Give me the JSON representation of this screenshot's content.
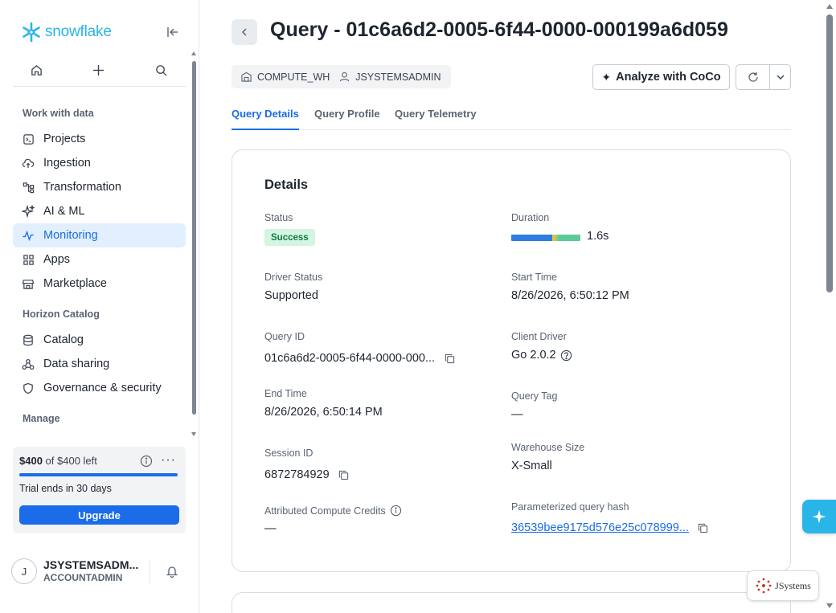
{
  "brand": {
    "name": "snowflake",
    "color": "#29b5e8"
  },
  "sidebar": {
    "sections": [
      {
        "label": "Work with data"
      },
      {
        "label": "Horizon Catalog"
      },
      {
        "label": "Manage"
      }
    ],
    "items": [
      {
        "label": "Projects",
        "icon": "projects-icon"
      },
      {
        "label": "Ingestion",
        "icon": "cloud-upload-icon"
      },
      {
        "label": "Transformation",
        "icon": "transformation-icon"
      },
      {
        "label": "AI & ML",
        "icon": "sparkles-icon"
      },
      {
        "label": "Monitoring",
        "icon": "activity-icon",
        "active": true
      },
      {
        "label": "Apps",
        "icon": "grid-icon"
      },
      {
        "label": "Marketplace",
        "icon": "store-icon"
      },
      {
        "label": "Catalog",
        "icon": "database-icon"
      },
      {
        "label": "Data sharing",
        "icon": "share-icon"
      },
      {
        "label": "Governance & security",
        "icon": "shield-icon"
      }
    ],
    "credits": {
      "amount": "$400",
      "of_text": "of $400 left",
      "remaining_fraction": 1.0,
      "trial_text": "Trial ends in 30 days",
      "upgrade_label": "Upgrade",
      "more_label": "···"
    },
    "user": {
      "initial": "J",
      "name": "JSYSTEMSADM...",
      "role": "ACCOUNTADMIN"
    }
  },
  "header": {
    "title": "Query - 01c6a6d2-0005-6f44-0000-000199a6d059",
    "warehouse": "COMPUTE_WH",
    "user": "JSYSTEMSADMIN",
    "analyze_label": "Analyze with CoCo"
  },
  "tabs": [
    {
      "label": "Query Details",
      "active": true
    },
    {
      "label": "Query Profile",
      "active": false
    },
    {
      "label": "Query Telemetry",
      "active": false
    }
  ],
  "details": {
    "heading": "Details",
    "status": {
      "label": "Status",
      "value": "Success"
    },
    "duration": {
      "label": "Duration",
      "value": "1.6s",
      "segments": [
        {
          "fraction": 0.59,
          "color": "#2f7de1"
        },
        {
          "fraction": 0.05,
          "color": "#e8c33a"
        },
        {
          "fraction": 0.03,
          "color": "#8ccf7e"
        },
        {
          "fraction": 0.33,
          "color": "#5ec99a"
        }
      ]
    },
    "driver_status": {
      "label": "Driver Status",
      "value": "Supported"
    },
    "start_time": {
      "label": "Start Time",
      "value": "8/26/2026, 6:50:12 PM"
    },
    "query_id": {
      "label": "Query ID",
      "value": "01c6a6d2-0005-6f44-0000-000..."
    },
    "client_driver": {
      "label": "Client Driver",
      "value": "Go 2.0.2"
    },
    "end_time": {
      "label": "End Time",
      "value": "8/26/2026, 6:50:14 PM"
    },
    "query_tag": {
      "label": "Query Tag",
      "value": "—"
    },
    "session_id": {
      "label": "Session ID",
      "value": "6872784929"
    },
    "warehouse_size": {
      "label": "Warehouse Size",
      "value": "X-Small"
    },
    "credits": {
      "label": "Attributed Compute Credits",
      "value": "—"
    },
    "query_hash": {
      "label": "Parameterized query hash",
      "value": "36539bee9175d576e25c078999..."
    }
  },
  "watermark": "JSystems",
  "colors": {
    "accent": "#1a6ce8",
    "active_bg": "#e2efff",
    "success_bg": "#d3f5e2",
    "success_text": "#127a45"
  }
}
